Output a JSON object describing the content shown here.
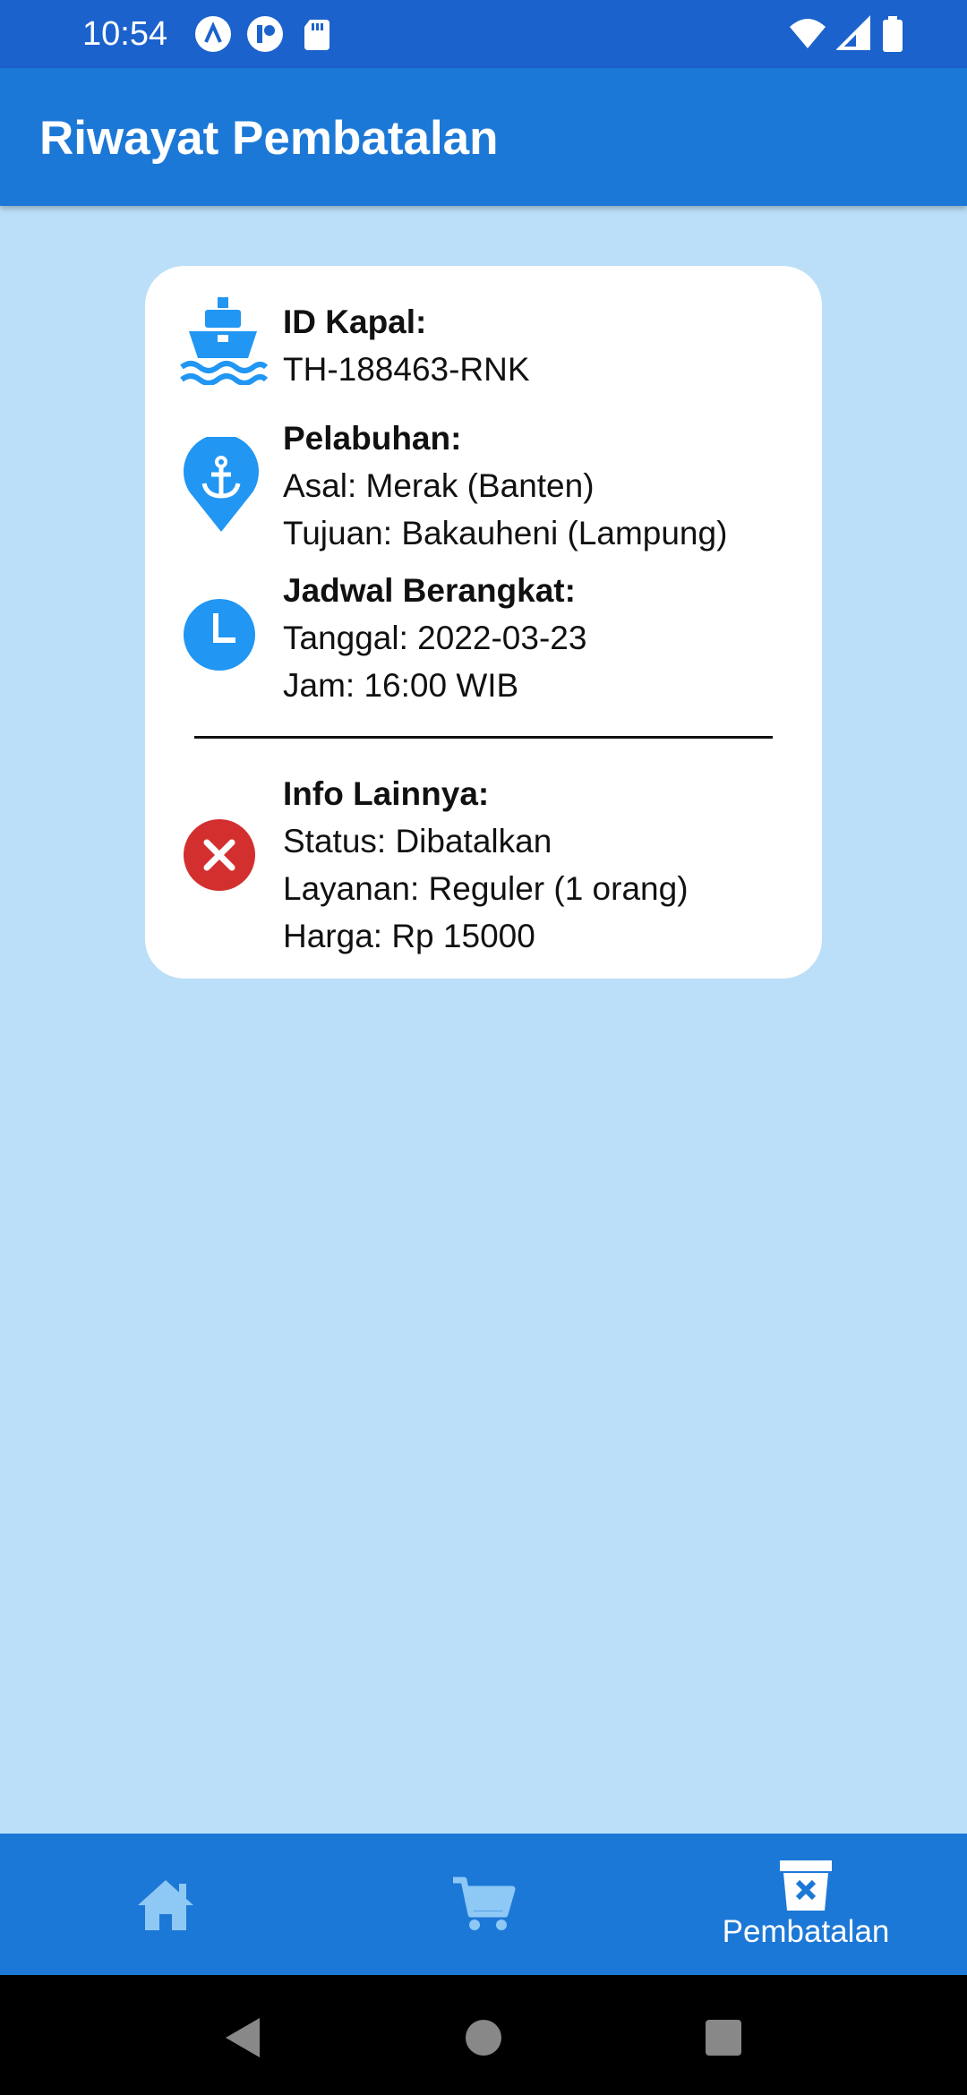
{
  "status_bar": {
    "time": "10:54"
  },
  "app_bar": {
    "title": "Riwayat Pembatalan"
  },
  "card": {
    "ship": {
      "label": "ID Kapal:",
      "value": "TH-188463-RNK"
    },
    "port": {
      "label": "Pelabuhan:",
      "origin": "Asal: Merak (Banten)",
      "destination": "Tujuan: Bakauheni (Lampung)"
    },
    "schedule": {
      "label": "Jadwal Berangkat:",
      "date": "Tanggal: 2022-03-23",
      "time": "Jam: 16:00 WIB"
    },
    "info": {
      "label": "Info Lainnya:",
      "status": "Status: Dibatalkan",
      "service": "Layanan: Reguler (1 orang)",
      "price": "Harga: Rp 15000"
    }
  },
  "bottom_nav": {
    "items": [
      {
        "icon": "home-icon",
        "label": ""
      },
      {
        "icon": "cart-icon",
        "label": ""
      },
      {
        "icon": "cancel-bin-icon",
        "label": "Pembatalan"
      }
    ]
  },
  "colors": {
    "status_bar": "#1b62cc",
    "app_bar": "#1c78d6",
    "background": "#bbdff8",
    "icon_blue": "#2196f3",
    "cancel_red": "#d32f2f"
  }
}
